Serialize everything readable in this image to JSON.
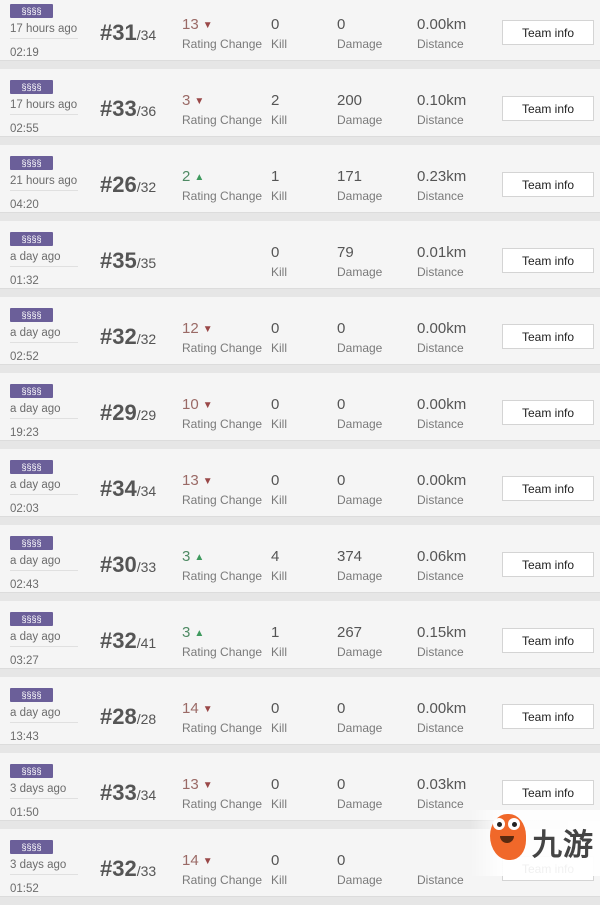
{
  "labels": {
    "rating_change": "Rating Change",
    "kill": "Kill",
    "damage": "Damage",
    "distance": "Distance",
    "team_info": "Team info"
  },
  "mode_badge_icon": "squad-runners-icon",
  "colors": {
    "badge": "#6b5f99",
    "rating_down": "#9a6a66",
    "rating_up": "#4f8a64",
    "logo_orange": "#f0682a"
  },
  "matches": [
    {
      "time_ago": "17 hours ago",
      "clock": "02:19",
      "rank": "#31",
      "total": "/34",
      "rating": "13",
      "rating_dir": "down",
      "kill": "0",
      "damage": "0",
      "distance": "0.00km"
    },
    {
      "time_ago": "17 hours ago",
      "clock": "02:55",
      "rank": "#33",
      "total": "/36",
      "rating": "3",
      "rating_dir": "down",
      "kill": "2",
      "damage": "200",
      "distance": "0.10km"
    },
    {
      "time_ago": "21 hours ago",
      "clock": "04:20",
      "rank": "#26",
      "total": "/32",
      "rating": "2",
      "rating_dir": "up",
      "kill": "1",
      "damage": "171",
      "distance": "0.23km"
    },
    {
      "time_ago": "a day ago",
      "clock": "01:32",
      "rank": "#35",
      "total": "/35",
      "rating": "",
      "rating_dir": "none",
      "kill": "0",
      "damage": "79",
      "distance": "0.01km"
    },
    {
      "time_ago": "a day ago",
      "clock": "02:52",
      "rank": "#32",
      "total": "/32",
      "rating": "12",
      "rating_dir": "down",
      "kill": "0",
      "damage": "0",
      "distance": "0.00km"
    },
    {
      "time_ago": "a day ago",
      "clock": "19:23",
      "rank": "#29",
      "total": "/29",
      "rating": "10",
      "rating_dir": "down",
      "kill": "0",
      "damage": "0",
      "distance": "0.00km"
    },
    {
      "time_ago": "a day ago",
      "clock": "02:03",
      "rank": "#34",
      "total": "/34",
      "rating": "13",
      "rating_dir": "down",
      "kill": "0",
      "damage": "0",
      "distance": "0.00km"
    },
    {
      "time_ago": "a day ago",
      "clock": "02:43",
      "rank": "#30",
      "total": "/33",
      "rating": "3",
      "rating_dir": "up",
      "kill": "4",
      "damage": "374",
      "distance": "0.06km"
    },
    {
      "time_ago": "a day ago",
      "clock": "03:27",
      "rank": "#32",
      "total": "/41",
      "rating": "3",
      "rating_dir": "up",
      "kill": "1",
      "damage": "267",
      "distance": "0.15km"
    },
    {
      "time_ago": "a day ago",
      "clock": "13:43",
      "rank": "#28",
      "total": "/28",
      "rating": "14",
      "rating_dir": "down",
      "kill": "0",
      "damage": "0",
      "distance": "0.00km"
    },
    {
      "time_ago": "3 days ago",
      "clock": "01:50",
      "rank": "#33",
      "total": "/34",
      "rating": "13",
      "rating_dir": "down",
      "kill": "0",
      "damage": "0",
      "distance": "0.03km"
    },
    {
      "time_ago": "3 days ago",
      "clock": "01:52",
      "rank": "#32",
      "total": "/33",
      "rating": "14",
      "rating_dir": "down",
      "kill": "0",
      "damage": "0",
      "distance": ""
    }
  ],
  "watermark": {
    "text": "九游",
    "icon": "jiuyou-mascot-logo"
  }
}
